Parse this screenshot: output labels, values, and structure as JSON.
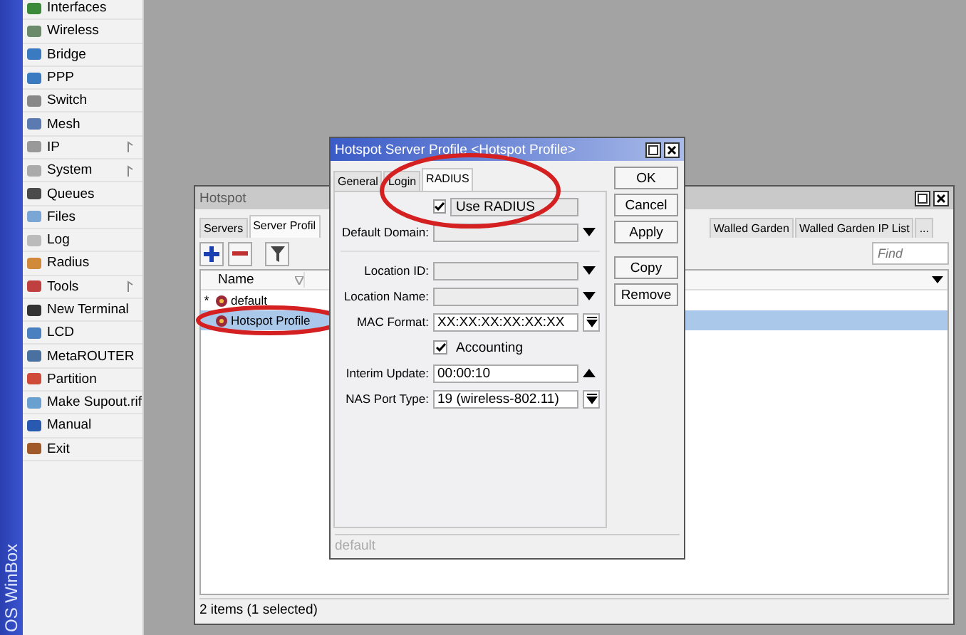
{
  "menu": {
    "brand": "OS WinBox",
    "items": [
      {
        "label": "Interfaces",
        "submenu": false
      },
      {
        "label": "Wireless",
        "submenu": false
      },
      {
        "label": "Bridge",
        "submenu": false
      },
      {
        "label": "PPP",
        "submenu": false
      },
      {
        "label": "Switch",
        "submenu": false
      },
      {
        "label": "Mesh",
        "submenu": false
      },
      {
        "label": "IP",
        "submenu": true
      },
      {
        "label": "System",
        "submenu": true
      },
      {
        "label": "Queues",
        "submenu": false
      },
      {
        "label": "Files",
        "submenu": false
      },
      {
        "label": "Log",
        "submenu": false
      },
      {
        "label": "Radius",
        "submenu": false
      },
      {
        "label": "Tools",
        "submenu": true
      },
      {
        "label": "New Terminal",
        "submenu": false
      },
      {
        "label": "LCD",
        "submenu": false
      },
      {
        "label": "MetaROUTER",
        "submenu": false
      },
      {
        "label": "Partition",
        "submenu": false
      },
      {
        "label": "Make Supout.rif",
        "submenu": false
      },
      {
        "label": "Manual",
        "submenu": false
      },
      {
        "label": "Exit",
        "submenu": false
      }
    ]
  },
  "hotspot_window": {
    "title": "Hotspot",
    "tabs_left": [
      {
        "label": "Servers",
        "selected": false
      },
      {
        "label": "Server Profil",
        "selected": true
      }
    ],
    "tabs_right": [
      {
        "label": "Walled Garden",
        "selected": false
      },
      {
        "label": "Walled Garden IP List",
        "selected": false
      },
      {
        "label": "...",
        "selected": false
      }
    ],
    "find_placeholder": "Find",
    "table": {
      "columns": [
        "Name"
      ],
      "rows": [
        {
          "flag": "*",
          "name": "default",
          "selected": false
        },
        {
          "name": "Hotspot Profile",
          "selected": true
        }
      ]
    },
    "status": "2 items (1 selected)"
  },
  "dialog": {
    "title": "Hotspot Server Profile <Hotspot Profile>",
    "tabs": [
      {
        "label": "General",
        "selected": false
      },
      {
        "label": "Login",
        "selected": false
      },
      {
        "label": "RADIUS",
        "selected": true
      }
    ],
    "form": [
      {
        "kind": "checkbox",
        "label": "Use RADIUS",
        "checked": true,
        "framed": true
      },
      {
        "kind": "dropdown",
        "label": "Default Domain:"
      },
      {
        "kind": "divider"
      },
      {
        "kind": "dropdown",
        "label": "Location ID:"
      },
      {
        "kind": "dropdown",
        "label": "Location Name:"
      },
      {
        "kind": "select",
        "label": "MAC Format:",
        "value": "XX:XX:XX:XX:XX:XX"
      },
      {
        "kind": "checkbox",
        "label": "Accounting",
        "checked": true,
        "framed": false
      },
      {
        "kind": "spin",
        "label": "Interim Update:",
        "value": "00:00:10"
      },
      {
        "kind": "select",
        "label": "NAS Port Type:",
        "value": "19 (wireless-802.11)"
      }
    ],
    "buttons": [
      "OK",
      "Cancel",
      "Apply",
      "Copy",
      "Remove"
    ],
    "status": "default"
  }
}
